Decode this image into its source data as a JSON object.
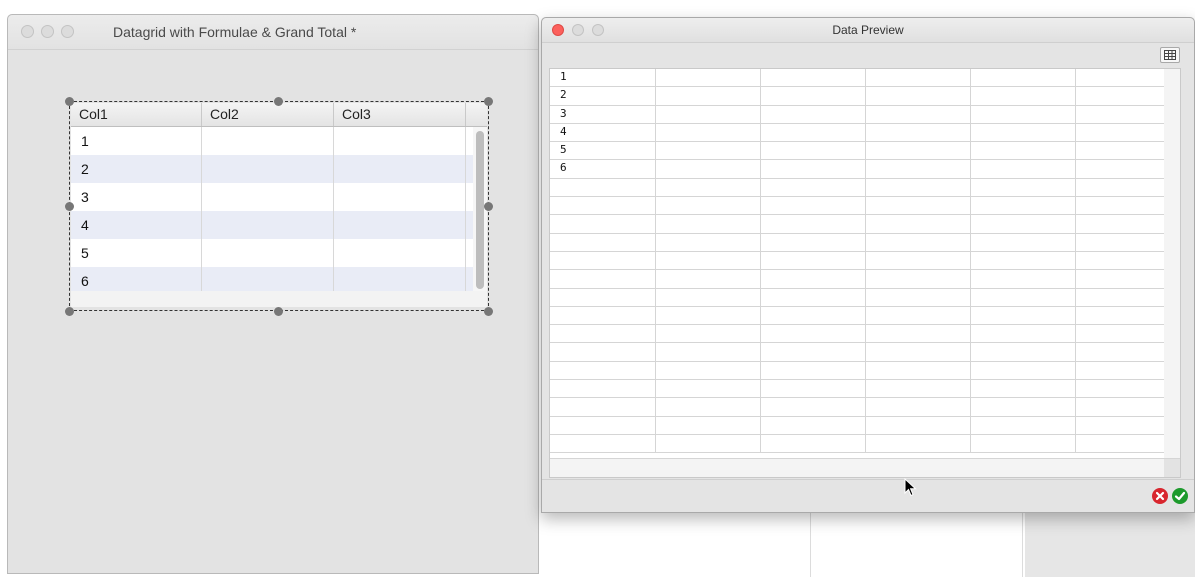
{
  "left_window": {
    "title": "Datagrid with Formulae & Grand Total *",
    "datagrid": {
      "columns": [
        "Col1",
        "Col2",
        "Col3"
      ],
      "rows": [
        "1",
        "2",
        "3",
        "4",
        "5",
        "6"
      ]
    }
  },
  "right_window": {
    "title": "Data Preview",
    "preview_rows": [
      "1",
      "2",
      "3",
      "4",
      "5",
      "6"
    ],
    "toolbar_icon": "table-grid-icon",
    "footer_icons": [
      "cancel-icon",
      "confirm-icon"
    ]
  },
  "colors": {
    "close_red": "#fc605c",
    "cancel_red": "#d8262e",
    "confirm_green": "#1d9a2c",
    "row_alt": "#e9ecf6"
  }
}
